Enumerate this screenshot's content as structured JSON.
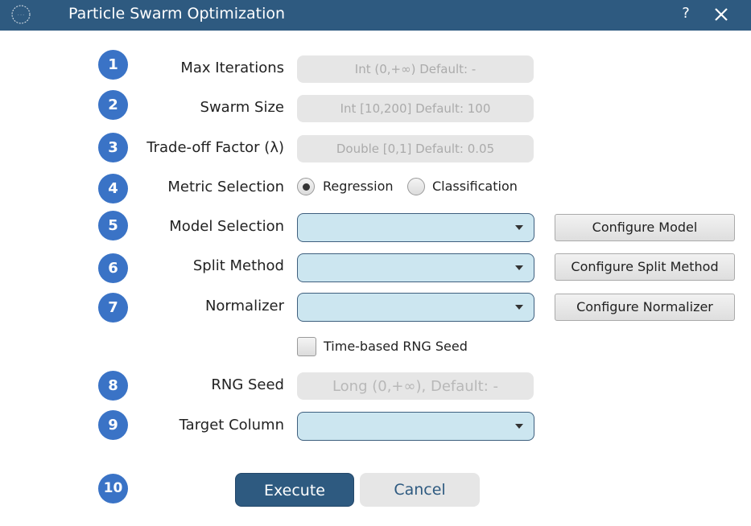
{
  "window": {
    "title": "Particle Swarm Optimization",
    "help_label": "?",
    "titlebar_color": "#2e5a80"
  },
  "icons": {
    "logo": "app-logo-icon",
    "close": "close-icon",
    "dropdown": "chevron-down-icon"
  },
  "steps": [
    {
      "number": "1",
      "label": "Max Iterations",
      "placeholder": "Int (0,+∞) Default: -"
    },
    {
      "number": "2",
      "label": "Swarm Size",
      "placeholder": "Int [10,200] Default: 100"
    },
    {
      "number": "3",
      "label": "Trade-off Factor (λ)",
      "placeholder": "Double [0,1] Default: 0.05"
    },
    {
      "number": "4",
      "label": "Metric Selection"
    },
    {
      "number": "5",
      "label": "Model Selection",
      "value": "",
      "button": "Configure Model"
    },
    {
      "number": "6",
      "label": "Split Method",
      "value": "",
      "button": "Configure Split Method"
    },
    {
      "number": "7",
      "label": "Normalizer",
      "value": "",
      "button": "Configure Normalizer"
    },
    {
      "number": "8",
      "label": "RNG Seed",
      "placeholder": "Long (0,+∞), Default: -"
    },
    {
      "number": "9",
      "label": "Target Column",
      "value": ""
    },
    {
      "number": "10"
    }
  ],
  "metric": {
    "options": [
      "Regression",
      "Classification"
    ],
    "selected": "Regression"
  },
  "time_seed": {
    "label": "Time-based RNG Seed",
    "checked": false
  },
  "actions": {
    "execute": "Execute",
    "cancel": "Cancel"
  },
  "colors": {
    "badge": "#3a73c6",
    "primary": "#2e5a80",
    "select_bg": "#cce6f0",
    "field_bg": "#e6e6e6"
  }
}
